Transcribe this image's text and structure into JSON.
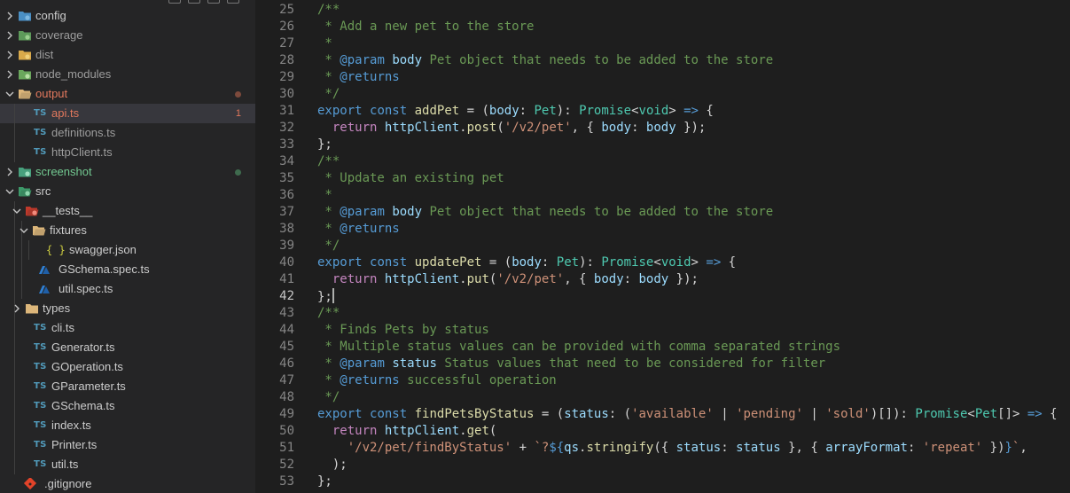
{
  "explorer": {
    "items": [
      {
        "label": "config",
        "kind": "folder",
        "icon": "config-folder-icon",
        "depth": 0,
        "chevron": "right",
        "color": "#cccccc"
      },
      {
        "label": "coverage",
        "kind": "folder",
        "icon": "coverage-folder-icon",
        "depth": 0,
        "chevron": "right",
        "color": "#9d9d9d"
      },
      {
        "label": "dist",
        "kind": "folder",
        "icon": "dist-folder-icon",
        "depth": 0,
        "chevron": "right",
        "color": "#9d9d9d"
      },
      {
        "label": "node_modules",
        "kind": "folder",
        "icon": "node-modules-folder-icon",
        "depth": 0,
        "chevron": "right",
        "color": "#9d9d9d"
      },
      {
        "label": "output",
        "kind": "folder",
        "icon": "open-folder-icon",
        "depth": 0,
        "chevron": "down",
        "color": "#e2785d",
        "dot": "#7d4a3c"
      },
      {
        "label": "api.ts",
        "kind": "ts",
        "icon": "typescript-file-icon",
        "depth": 1,
        "color": "#e2785d",
        "badge": "1",
        "selected": true
      },
      {
        "label": "definitions.ts",
        "kind": "ts",
        "icon": "typescript-file-icon",
        "depth": 1,
        "color": "#9d9d9d"
      },
      {
        "label": "httpClient.ts",
        "kind": "ts",
        "icon": "typescript-file-icon",
        "depth": 1,
        "color": "#9d9d9d"
      },
      {
        "label": "screenshot",
        "kind": "folder",
        "icon": "screenshot-folder-icon",
        "depth": 0,
        "chevron": "right",
        "color": "#73c991",
        "dot": "#3f6b4e"
      },
      {
        "label": "src",
        "kind": "folder",
        "icon": "src-folder-icon",
        "depth": 0,
        "chevron": "down",
        "color": "#cccccc"
      },
      {
        "label": "__tests__",
        "kind": "folder",
        "icon": "tests-folder-icon",
        "depth": 1,
        "chevron": "down",
        "color": "#cccccc"
      },
      {
        "label": "fixtures",
        "kind": "folder",
        "icon": "open-folder-icon",
        "depth": 2,
        "chevron": "down",
        "color": "#cccccc"
      },
      {
        "label": "swagger.json",
        "kind": "json",
        "icon": "json-file-icon",
        "depth": 3,
        "color": "#cccccc"
      },
      {
        "label": "GSchema.spec.ts",
        "kind": "spec",
        "icon": "test-spec-file-icon",
        "depth": 2,
        "color": "#cccccc"
      },
      {
        "label": "util.spec.ts",
        "kind": "spec",
        "icon": "test-spec-file-icon",
        "depth": 2,
        "color": "#cccccc"
      },
      {
        "label": "types",
        "kind": "folder",
        "icon": "folder-icon",
        "depth": 1,
        "chevron": "right",
        "color": "#cccccc"
      },
      {
        "label": "cli.ts",
        "kind": "ts",
        "icon": "typescript-file-icon",
        "depth": 1,
        "color": "#cccccc"
      },
      {
        "label": "Generator.ts",
        "kind": "ts",
        "icon": "typescript-file-icon",
        "depth": 1,
        "color": "#cccccc"
      },
      {
        "label": "GOperation.ts",
        "kind": "ts",
        "icon": "typescript-file-icon",
        "depth": 1,
        "color": "#cccccc"
      },
      {
        "label": "GParameter.ts",
        "kind": "ts",
        "icon": "typescript-file-icon",
        "depth": 1,
        "color": "#cccccc"
      },
      {
        "label": "GSchema.ts",
        "kind": "ts",
        "icon": "typescript-file-icon",
        "depth": 1,
        "color": "#cccccc"
      },
      {
        "label": "index.ts",
        "kind": "ts",
        "icon": "typescript-file-icon",
        "depth": 1,
        "color": "#cccccc"
      },
      {
        "label": "Printer.ts",
        "kind": "ts",
        "icon": "typescript-file-icon",
        "depth": 1,
        "color": "#cccccc"
      },
      {
        "label": "util.ts",
        "kind": "ts",
        "icon": "typescript-file-icon",
        "depth": 1,
        "color": "#cccccc"
      },
      {
        "label": ".gitignore",
        "kind": "git",
        "icon": "git-file-icon",
        "depth": 0,
        "color": "#cccccc"
      }
    ],
    "ts_icon_text": "TS",
    "json_icon_text": "{ }"
  },
  "editor": {
    "active_line": "42",
    "lines": [
      {
        "n": "25",
        "tokens": [
          [
            "cmt",
            "/**"
          ]
        ]
      },
      {
        "n": "26",
        "tokens": [
          [
            "cmt",
            " * Add a new pet to the store"
          ]
        ]
      },
      {
        "n": "27",
        "tokens": [
          [
            "cmt",
            " *"
          ]
        ]
      },
      {
        "n": "28",
        "tokens": [
          [
            "cmt",
            " * "
          ],
          [
            "ckw",
            "@param"
          ],
          [
            "cmt",
            " "
          ],
          [
            "cid",
            "body"
          ],
          [
            "cmt",
            " Pet object that needs to be added to the store"
          ]
        ]
      },
      {
        "n": "29",
        "tokens": [
          [
            "cmt",
            " * "
          ],
          [
            "ckw",
            "@returns"
          ]
        ]
      },
      {
        "n": "30",
        "tokens": [
          [
            "cmt",
            " */"
          ]
        ]
      },
      {
        "n": "31",
        "tokens": [
          [
            "kw",
            "export"
          ],
          [
            "pl",
            " "
          ],
          [
            "kw",
            "const"
          ],
          [
            "pl",
            " "
          ],
          [
            "fn",
            "addPet"
          ],
          [
            "pl",
            " = ("
          ],
          [
            "var",
            "body"
          ],
          [
            "pl",
            ": "
          ],
          [
            "type",
            "Pet"
          ],
          [
            "pl",
            "): "
          ],
          [
            "type",
            "Promise"
          ],
          [
            "pl",
            "<"
          ],
          [
            "type",
            "void"
          ],
          [
            "pl",
            "> "
          ],
          [
            "kw",
            "=>"
          ],
          [
            "pl",
            " {"
          ]
        ]
      },
      {
        "n": "32",
        "tokens": [
          [
            "pl",
            "  "
          ],
          [
            "ctl",
            "return"
          ],
          [
            "pl",
            " "
          ],
          [
            "var",
            "httpClient"
          ],
          [
            "pl",
            "."
          ],
          [
            "fn",
            "post"
          ],
          [
            "pl",
            "("
          ],
          [
            "str",
            "'/v2/pet'"
          ],
          [
            "pl",
            ", { "
          ],
          [
            "var",
            "body"
          ],
          [
            "pl",
            ": "
          ],
          [
            "var",
            "body"
          ],
          [
            "pl",
            " });"
          ]
        ]
      },
      {
        "n": "33",
        "tokens": [
          [
            "pl",
            "};"
          ]
        ]
      },
      {
        "n": "34",
        "tokens": [
          [
            "cmt",
            "/**"
          ]
        ]
      },
      {
        "n": "35",
        "tokens": [
          [
            "cmt",
            " * Update an existing pet"
          ]
        ]
      },
      {
        "n": "36",
        "tokens": [
          [
            "cmt",
            " *"
          ]
        ]
      },
      {
        "n": "37",
        "tokens": [
          [
            "cmt",
            " * "
          ],
          [
            "ckw",
            "@param"
          ],
          [
            "cmt",
            " "
          ],
          [
            "cid",
            "body"
          ],
          [
            "cmt",
            " Pet object that needs to be added to the store"
          ]
        ]
      },
      {
        "n": "38",
        "tokens": [
          [
            "cmt",
            " * "
          ],
          [
            "ckw",
            "@returns"
          ]
        ]
      },
      {
        "n": "39",
        "tokens": [
          [
            "cmt",
            " */"
          ]
        ]
      },
      {
        "n": "40",
        "tokens": [
          [
            "kw",
            "export"
          ],
          [
            "pl",
            " "
          ],
          [
            "kw",
            "const"
          ],
          [
            "pl",
            " "
          ],
          [
            "fn",
            "updatePet"
          ],
          [
            "pl",
            " = ("
          ],
          [
            "var",
            "body"
          ],
          [
            "pl",
            ": "
          ],
          [
            "type",
            "Pet"
          ],
          [
            "pl",
            "): "
          ],
          [
            "type",
            "Promise"
          ],
          [
            "pl",
            "<"
          ],
          [
            "type",
            "void"
          ],
          [
            "pl",
            "> "
          ],
          [
            "kw",
            "=>"
          ],
          [
            "pl",
            " {"
          ]
        ]
      },
      {
        "n": "41",
        "tokens": [
          [
            "pl",
            "  "
          ],
          [
            "ctl",
            "return"
          ],
          [
            "pl",
            " "
          ],
          [
            "var",
            "httpClient"
          ],
          [
            "pl",
            "."
          ],
          [
            "fn",
            "put"
          ],
          [
            "pl",
            "("
          ],
          [
            "str",
            "'/v2/pet'"
          ],
          [
            "pl",
            ", { "
          ],
          [
            "var",
            "body"
          ],
          [
            "pl",
            ": "
          ],
          [
            "var",
            "body"
          ],
          [
            "pl",
            " });"
          ]
        ]
      },
      {
        "n": "42",
        "tokens": [
          [
            "pl",
            "};"
          ]
        ],
        "cursor": true
      },
      {
        "n": "43",
        "tokens": [
          [
            "cmt",
            "/**"
          ]
        ]
      },
      {
        "n": "44",
        "tokens": [
          [
            "cmt",
            " * Finds Pets by status"
          ]
        ]
      },
      {
        "n": "45",
        "tokens": [
          [
            "cmt",
            " * Multiple status values can be provided with comma separated strings"
          ]
        ]
      },
      {
        "n": "46",
        "tokens": [
          [
            "cmt",
            " * "
          ],
          [
            "ckw",
            "@param"
          ],
          [
            "cmt",
            " "
          ],
          [
            "cid",
            "status"
          ],
          [
            "cmt",
            " Status values that need to be considered for filter"
          ]
        ]
      },
      {
        "n": "47",
        "tokens": [
          [
            "cmt",
            " * "
          ],
          [
            "ckw",
            "@returns"
          ],
          [
            "cmt",
            " successful operation"
          ]
        ]
      },
      {
        "n": "48",
        "tokens": [
          [
            "cmt",
            " */"
          ]
        ]
      },
      {
        "n": "49",
        "tokens": [
          [
            "kw",
            "export"
          ],
          [
            "pl",
            " "
          ],
          [
            "kw",
            "const"
          ],
          [
            "pl",
            " "
          ],
          [
            "fn",
            "findPetsByStatus"
          ],
          [
            "pl",
            " = ("
          ],
          [
            "var",
            "status"
          ],
          [
            "pl",
            ": ("
          ],
          [
            "str",
            "'available'"
          ],
          [
            "pl",
            " | "
          ],
          [
            "str",
            "'pending'"
          ],
          [
            "pl",
            " | "
          ],
          [
            "str",
            "'sold'"
          ],
          [
            "pl",
            ")[]): "
          ],
          [
            "type",
            "Promise"
          ],
          [
            "pl",
            "<"
          ],
          [
            "type",
            "Pet"
          ],
          [
            "pl",
            "[]> "
          ],
          [
            "kw",
            "=>"
          ],
          [
            "pl",
            " {"
          ]
        ]
      },
      {
        "n": "50",
        "tokens": [
          [
            "pl",
            "  "
          ],
          [
            "ctl",
            "return"
          ],
          [
            "pl",
            " "
          ],
          [
            "var",
            "httpClient"
          ],
          [
            "pl",
            "."
          ],
          [
            "fn",
            "get"
          ],
          [
            "pl",
            "("
          ]
        ]
      },
      {
        "n": "51",
        "tokens": [
          [
            "pl",
            "    "
          ],
          [
            "str",
            "'/v2/pet/findByStatus'"
          ],
          [
            "pl",
            " + "
          ],
          [
            "str",
            "`?"
          ],
          [
            "kw",
            "${"
          ],
          [
            "var",
            "qs"
          ],
          [
            "pl",
            "."
          ],
          [
            "fn",
            "stringify"
          ],
          [
            "pl",
            "({ "
          ],
          [
            "var",
            "status"
          ],
          [
            "pl",
            ": "
          ],
          [
            "var",
            "status"
          ],
          [
            "pl",
            " }, { "
          ],
          [
            "var",
            "arrayFormat"
          ],
          [
            "pl",
            ": "
          ],
          [
            "str",
            "'repeat'"
          ],
          [
            "pl",
            " })"
          ],
          [
            "kw",
            "}"
          ],
          [
            "str",
            "`"
          ],
          [
            "pl",
            ","
          ]
        ]
      },
      {
        "n": "52",
        "tokens": [
          [
            "pl",
            "  );"
          ]
        ]
      },
      {
        "n": "53",
        "tokens": [
          [
            "pl",
            "};"
          ]
        ]
      }
    ]
  }
}
